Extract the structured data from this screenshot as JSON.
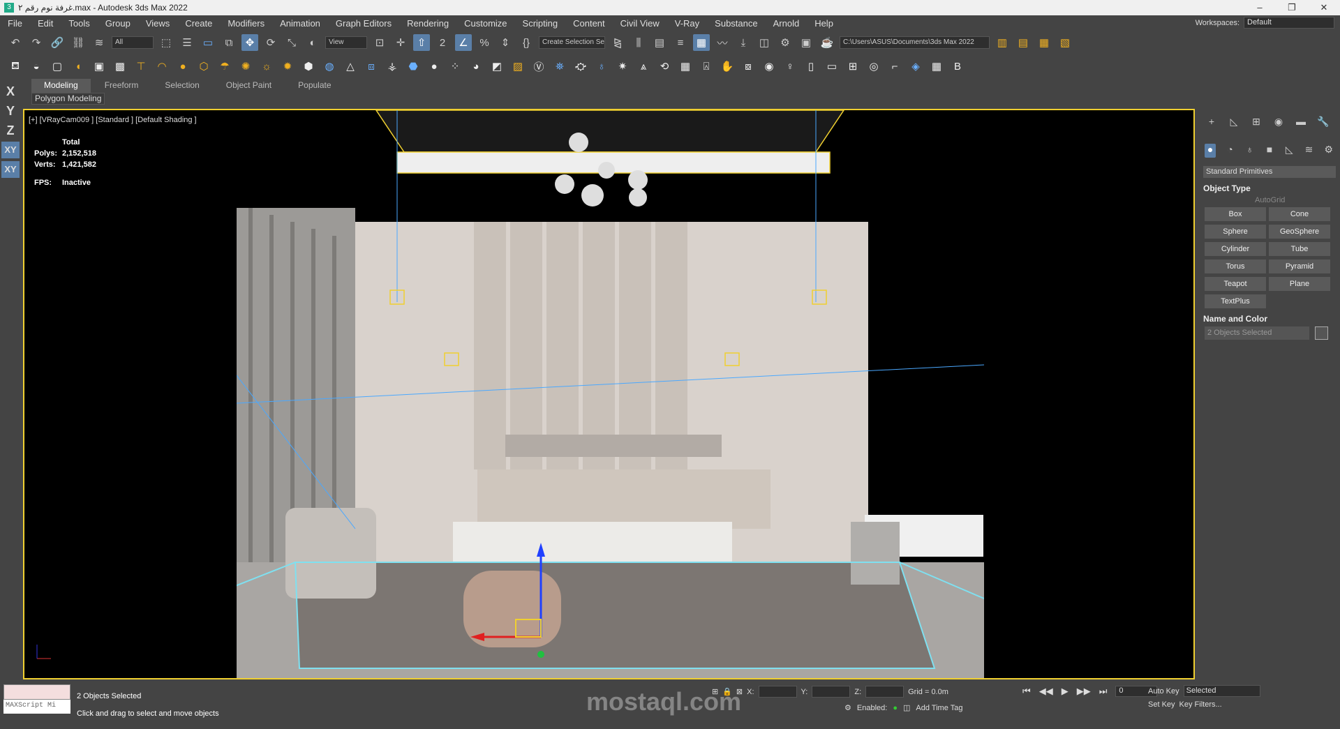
{
  "window": {
    "title": "غرفة نوم رقم ٢.max - Autodesk 3ds Max 2022"
  },
  "menu": [
    "File",
    "Edit",
    "Tools",
    "Group",
    "Views",
    "Create",
    "Modifiers",
    "Animation",
    "Graph Editors",
    "Rendering",
    "Customize",
    "Scripting",
    "Content",
    "Civil View",
    "V-Ray",
    "Substance",
    "Arnold",
    "Help"
  ],
  "workspace": {
    "label": "Workspaces:",
    "value": "Default"
  },
  "toolbar": {
    "filter_value": "All",
    "refcoord_value": "View",
    "selection_set_placeholder": "Create Selection Se",
    "project_path": "C:\\Users\\ASUS\\Documents\\3ds Max 2022"
  },
  "axes": [
    "X",
    "Y",
    "Z",
    "XY",
    "XY"
  ],
  "ribbon": {
    "tabs": [
      "Modeling",
      "Freeform",
      "Selection",
      "Object Paint",
      "Populate"
    ],
    "subtab": "Polygon Modeling"
  },
  "viewport": {
    "label": "[+] [VRayCam009 ] [Standard ] [Default Shading ]",
    "stats_header": "Total",
    "polys_label": "Polys:",
    "polys_value": "2,152,518",
    "verts_label": "Verts:",
    "verts_value": "1,421,582",
    "fps_label": "FPS:",
    "fps_value": "Inactive"
  },
  "command_panel": {
    "category": "Standard Primitives",
    "object_type_header": "Object Type",
    "autogrid": "AutoGrid",
    "buttons": [
      "Box",
      "Cone",
      "Sphere",
      "GeoSphere",
      "Cylinder",
      "Tube",
      "Torus",
      "Pyramid",
      "Teapot",
      "Plane",
      "TextPlus"
    ],
    "name_color_header": "Name and Color",
    "name_value": "2 Objects Selected"
  },
  "status": {
    "maxscript": "MAXScript Mi",
    "selected_count": "2 Objects Selected",
    "prompt": "Click and drag to select and move objects",
    "x_label": "X:",
    "y_label": "Y:",
    "z_label": "Z:",
    "grid": "Grid = 0.0m",
    "enabled_label": "Enabled:",
    "add_time_tag": "Add Time Tag",
    "frame": "0",
    "auto_key": "Auto Key",
    "set_key": "Set Key",
    "selected_dd": "Selected",
    "key_filters": "Key Filters..."
  },
  "watermark": "mostaql.com"
}
